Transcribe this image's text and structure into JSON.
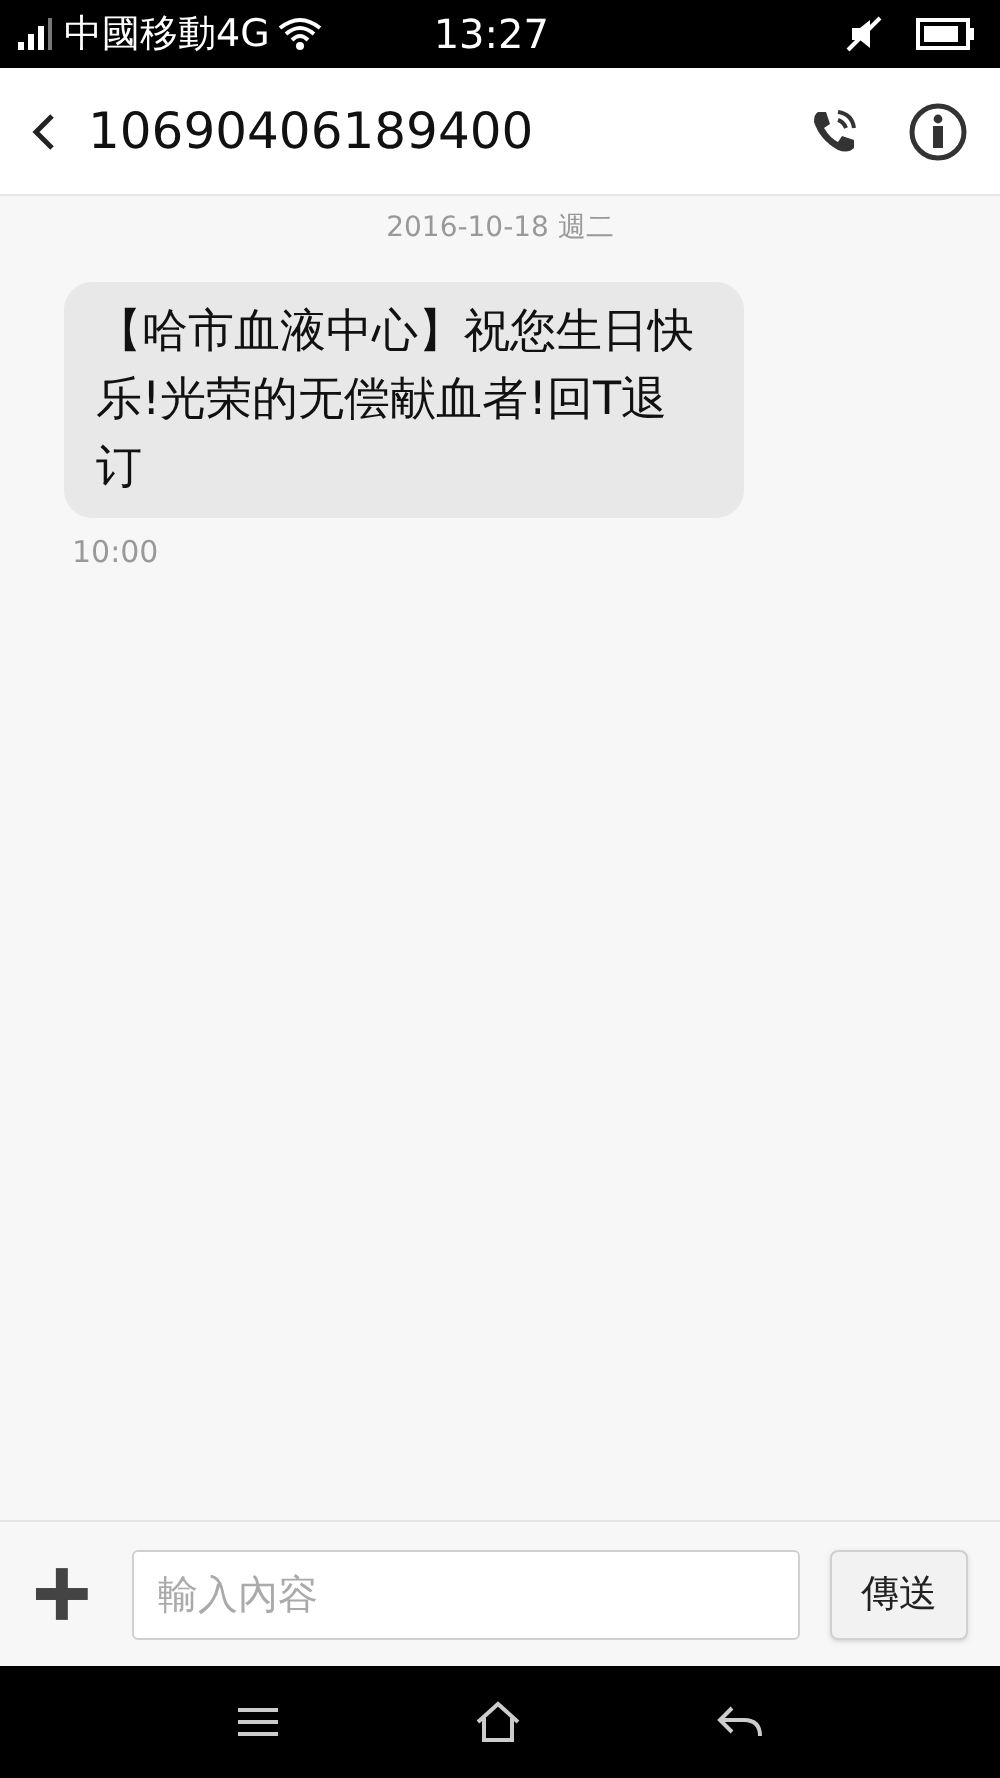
{
  "status_bar": {
    "carrier": "中國移動4G",
    "time": "13:27"
  },
  "header": {
    "title": "10690406189400"
  },
  "date_label": "2016-10-18 週二",
  "messages": [
    {
      "text": "【哈市血液中心】祝您生日快乐!光荣的无偿献血者!回T退订",
      "time": "10:00"
    }
  ],
  "composer": {
    "placeholder": "輸入內容",
    "send_label": "傳送"
  }
}
